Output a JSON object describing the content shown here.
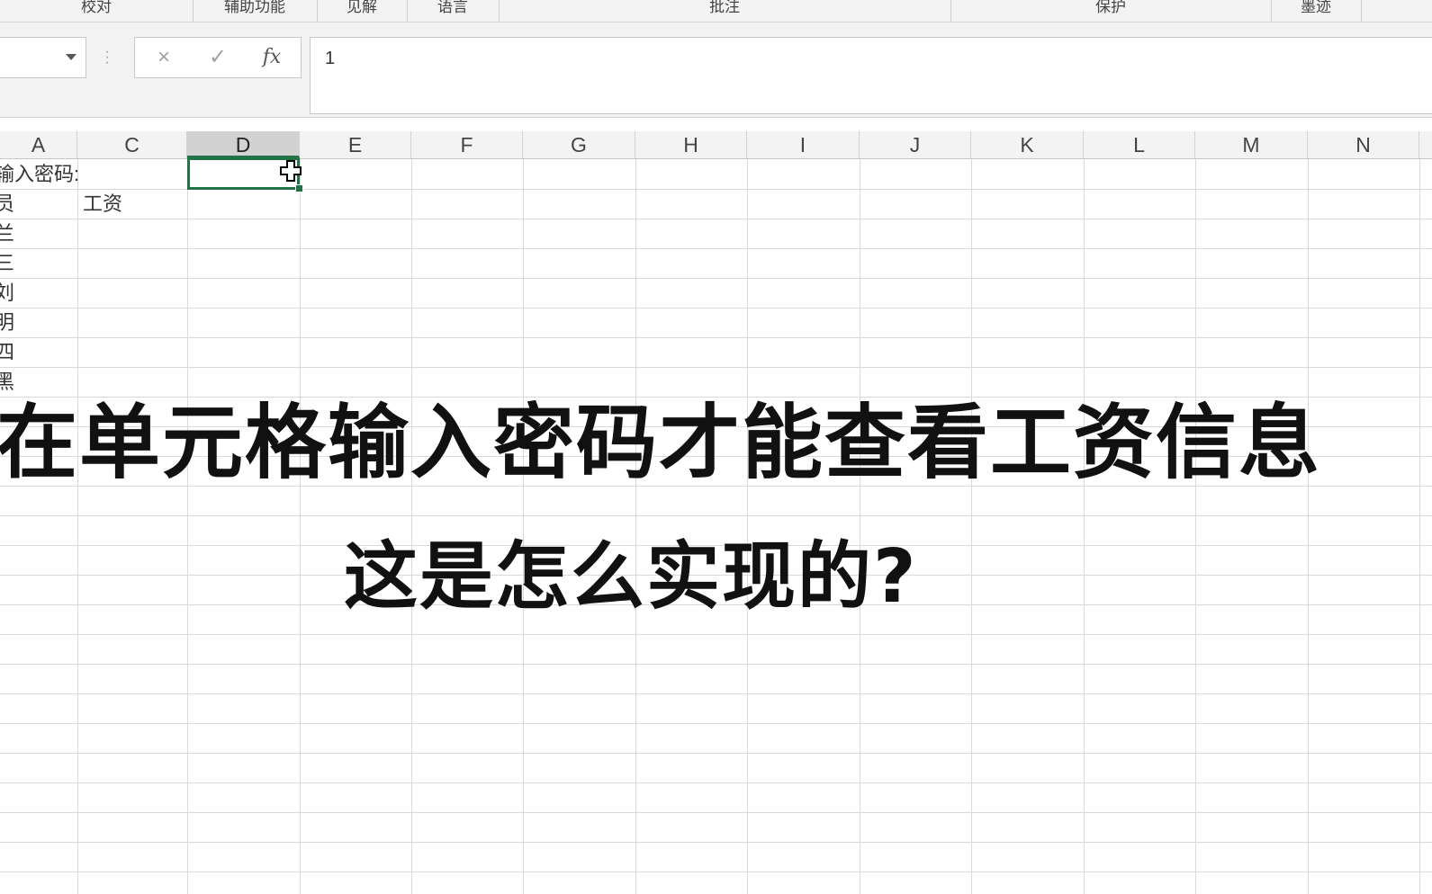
{
  "ribbon": {
    "groups": [
      "校对",
      "辅助功能",
      "见解",
      "语言",
      "批注",
      "保护",
      "墨迹"
    ]
  },
  "formula_bar": {
    "name_box": "",
    "cancel_icon": "×",
    "enter_icon": "✓",
    "fx_label": "fx",
    "value": "1"
  },
  "columns": [
    "A",
    "C",
    "D",
    "E",
    "F",
    "G",
    "H",
    "I",
    "J",
    "K",
    "L",
    "M",
    "N"
  ],
  "selected_column": "D",
  "cells": {
    "a1": "输入密码:",
    "a2": "员",
    "c2": "工资",
    "a3": "兰",
    "a4": "三",
    "a5": "刘",
    "a6": "明",
    "a7": "四",
    "a8": "黑"
  },
  "overlay": {
    "line1": "在单元格输入密码才能查看工资信息",
    "line2": "这是怎么实现的?"
  },
  "colors": {
    "selection": "#217346",
    "gridline": "#d9d9d9",
    "header_bg": "#f3f3f3"
  }
}
